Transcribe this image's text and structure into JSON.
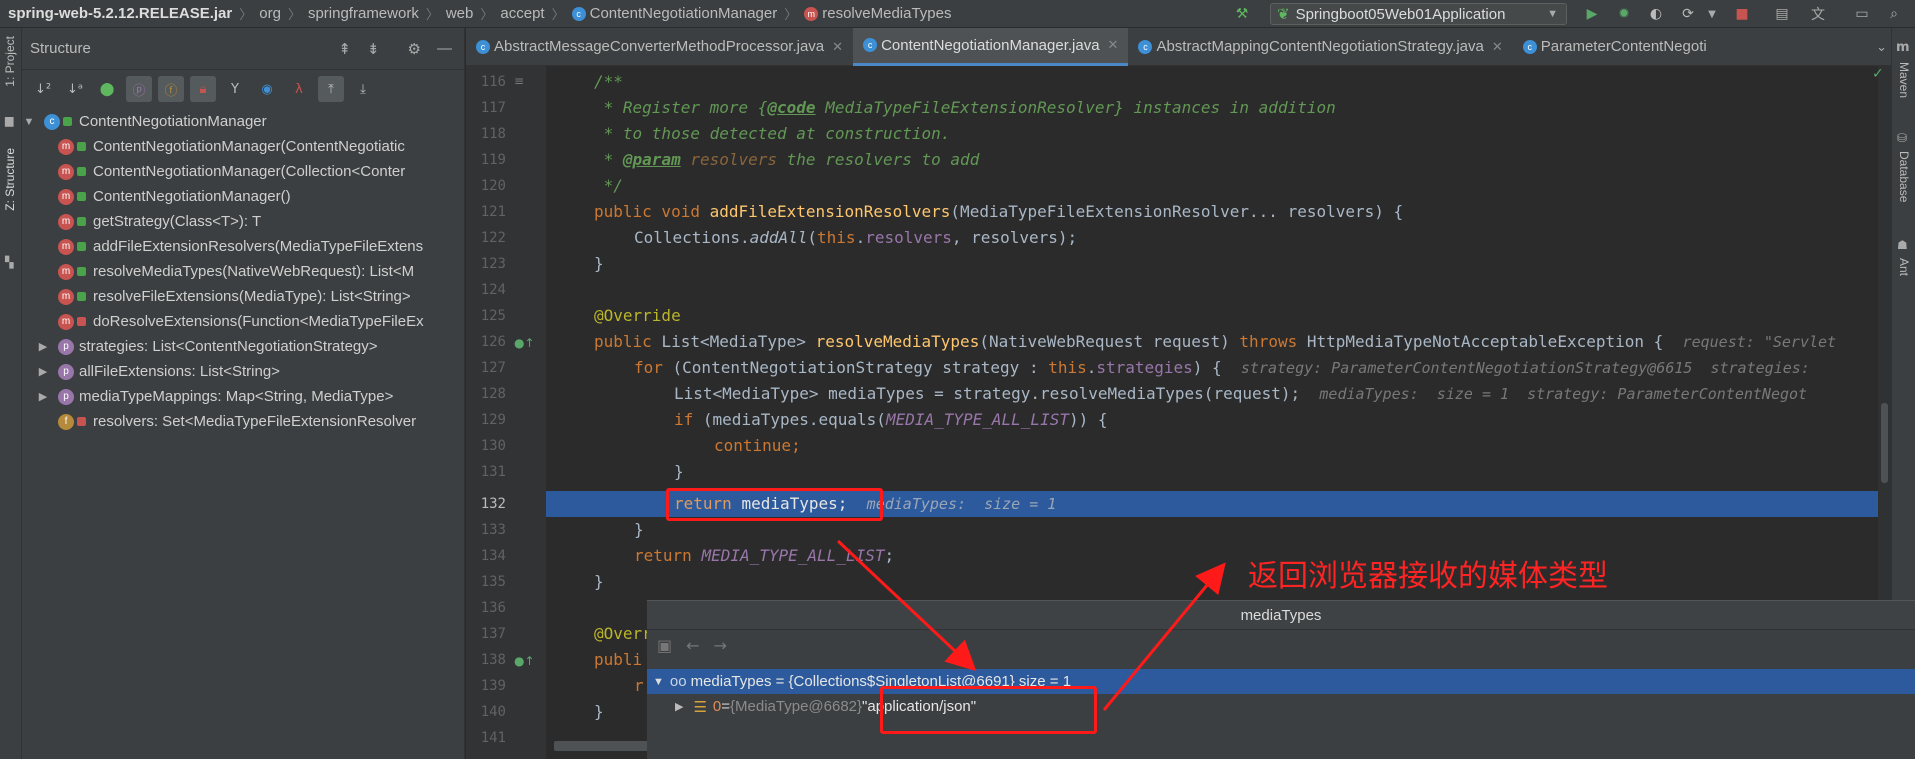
{
  "breadcrumb": {
    "jar": "spring-web-5.2.12.RELEASE.jar",
    "items": [
      "org",
      "springframework",
      "web",
      "accept"
    ],
    "class": "ContentNegotiationManager",
    "method": "resolveMediaTypes"
  },
  "run_config": "Springboot05Web01Application",
  "left_strip": {
    "project": "1: Project",
    "structure": "Z: Structure"
  },
  "right_strip": {
    "maven": "Maven",
    "database": "Database",
    "ant": "Ant"
  },
  "structure": {
    "title": "Structure",
    "root": "ContentNegotiationManager",
    "methods": [
      "ContentNegotiationManager(ContentNegotiatic",
      "ContentNegotiationManager(Collection<Conter",
      "ContentNegotiationManager()",
      "getStrategy(Class<T>): T",
      "addFileExtensionResolvers(MediaTypeFileExtens",
      "resolveMediaTypes(NativeWebRequest): List<M",
      "resolveFileExtensions(MediaType): List<String>",
      "doResolveExtensions(Function<MediaTypeFileEx"
    ],
    "properties": [
      "strategies: List<ContentNegotiationStrategy>",
      "allFileExtensions: List<String>",
      "mediaTypeMappings: Map<String, MediaType>"
    ],
    "field": "resolvers: Set<MediaTypeFileExtensionResolver"
  },
  "tabs": [
    {
      "label": "AbstractMessageConverterMethodProcessor.java"
    },
    {
      "label": "ContentNegotiationManager.java"
    },
    {
      "label": "AbstractMappingContentNegotiationStrategy.java"
    },
    {
      "label": "ParameterContentNegoti"
    }
  ],
  "gutter_lines": [
    "116",
    "117",
    "118",
    "119",
    "120",
    "121",
    "122",
    "123",
    "124",
    "125",
    "126",
    "127",
    "128",
    "129",
    "130",
    "131",
    "132",
    "133",
    "134",
    "135",
    "136",
    "137",
    "138",
    "139",
    "140",
    "141"
  ],
  "code": {
    "l116": "/**",
    "l117a": " * Register more {",
    "l117tag": "@code",
    "l117b": " MediaTypeFileExtensionResolver} instances in addition",
    "l118": " * to those detected at construction.",
    "l119a": " * ",
    "l119tag": "@param",
    "l119p": " resolvers",
    "l119b": " the resolvers to add",
    "l120": " */",
    "l121_kw": "public void ",
    "l121_fn": "addFileExtensionResolvers",
    "l121_rest": "(MediaTypeFileExtensionResolver... resolvers) {",
    "l122_a": "Collections.",
    "l122_it": "addAll",
    "l122_b": "(",
    "l122_this": "this",
    "l122_c": ".",
    "l122_fld": "resolvers",
    "l122_d": ", resolvers);",
    "l123": "}",
    "l125": "@Override",
    "l126_kw": "public ",
    "l126_a": "List<MediaType> ",
    "l126_fn": "resolveMediaTypes",
    "l126_b": "(NativeWebRequest request) ",
    "l126_kw2": "throws ",
    "l126_c": "HttpMediaTypeNotAcceptableException {",
    "l126_hint": "request: \"Servlet",
    "l127_kw": "for ",
    "l127_a": "(ContentNegotiationStrategy strategy : ",
    "l127_this": "this",
    "l127_b": ".",
    "l127_fld": "strategies",
    "l127_c": ") {",
    "l127_hint": "strategy: ParameterContentNegotiationStrategy@6615  strategies:",
    "l128": "List<MediaType> mediaTypes = strategy.resolveMediaTypes(request);",
    "l128_hint": "mediaTypes:  size = 1  strategy: ParameterContentNegot",
    "l129_kw": "if ",
    "l129_a": "(mediaTypes.equals(",
    "l129_fld": "MEDIA_TYPE_ALL_LIST",
    "l129_b": ")) {",
    "l130": "continue;",
    "l131": "}",
    "l132_kw": "return ",
    "l132_a": "mediaTypes;",
    "l132_hint": "mediaTypes:  size = 1",
    "l133": "}",
    "l134_kw": "return ",
    "l134_fld": "MEDIA_TYPE_ALL_LIST",
    "l134_a": ";",
    "l135": "}",
    "l137": "@Overr",
    "l138": "publi",
    "l139": "r",
    "l140": "}"
  },
  "popup": {
    "title": "mediaTypes",
    "row1": "mediaTypes = {Collections$SingletonList@6691}  size = 1",
    "row2_key": "0",
    "row2_eq": " = ",
    "row2_obj": "{MediaType@6682}",
    "row2_val": " \"application/json\""
  },
  "annotation": "返回浏览器接收的媒体类型",
  "colors": {
    "accent": "#2d5a9c",
    "annotation": "#ff1a1a",
    "keyword": "#cc7832",
    "comment": "#629755"
  }
}
